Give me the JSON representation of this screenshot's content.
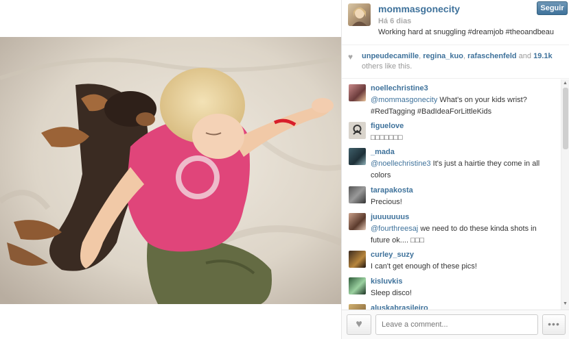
{
  "post": {
    "owner": "mommasgonecity",
    "age": "Há 6 dias",
    "caption": "Working hard at snuggling #dreamjob #theoandbeau",
    "follow_label": "Seguir"
  },
  "likes": {
    "users": [
      "unpeudecamille",
      "regina_kuo",
      "rafaschenfeld"
    ],
    "separator": ",",
    "and_text": "and",
    "count": "19.1k",
    "suffix": "others like this."
  },
  "comments": [
    {
      "user": "noellechristine3",
      "mention": "@mommasgonecity",
      "text": " What's on your kids wrist? #RedTagging #BadIdeaForLittleKids"
    },
    {
      "user": "figuelove",
      "mention": "",
      "text": "□□□□□□□"
    },
    {
      "user": "_mada",
      "mention": "@noellechristine3",
      "text": " It's just a hairtie they come in all colors"
    },
    {
      "user": "tarapakosta",
      "mention": "",
      "text": "Precious!"
    },
    {
      "user": "juuuuuuus",
      "mention": "@fourthreesaj",
      "text": " we need to do these kinda shots in future ok.... □□□"
    },
    {
      "user": "curley_suzy",
      "mention": "",
      "text": "I can't get enough of these pics!"
    },
    {
      "user": "kisluvkis",
      "mention": "",
      "text": "Sleep disco!"
    },
    {
      "user": "aluskabrasileiro",
      "mention": "",
      "text": ""
    }
  ],
  "footer": {
    "comment_placeholder": "Leave a comment...",
    "more_label": "•••"
  },
  "icons": {
    "like": "heart-icon",
    "more": "ellipsis-icon"
  },
  "colors": {
    "link": "#3f729b",
    "follow_button": "#3f729b",
    "shirt": "#e0457a"
  }
}
